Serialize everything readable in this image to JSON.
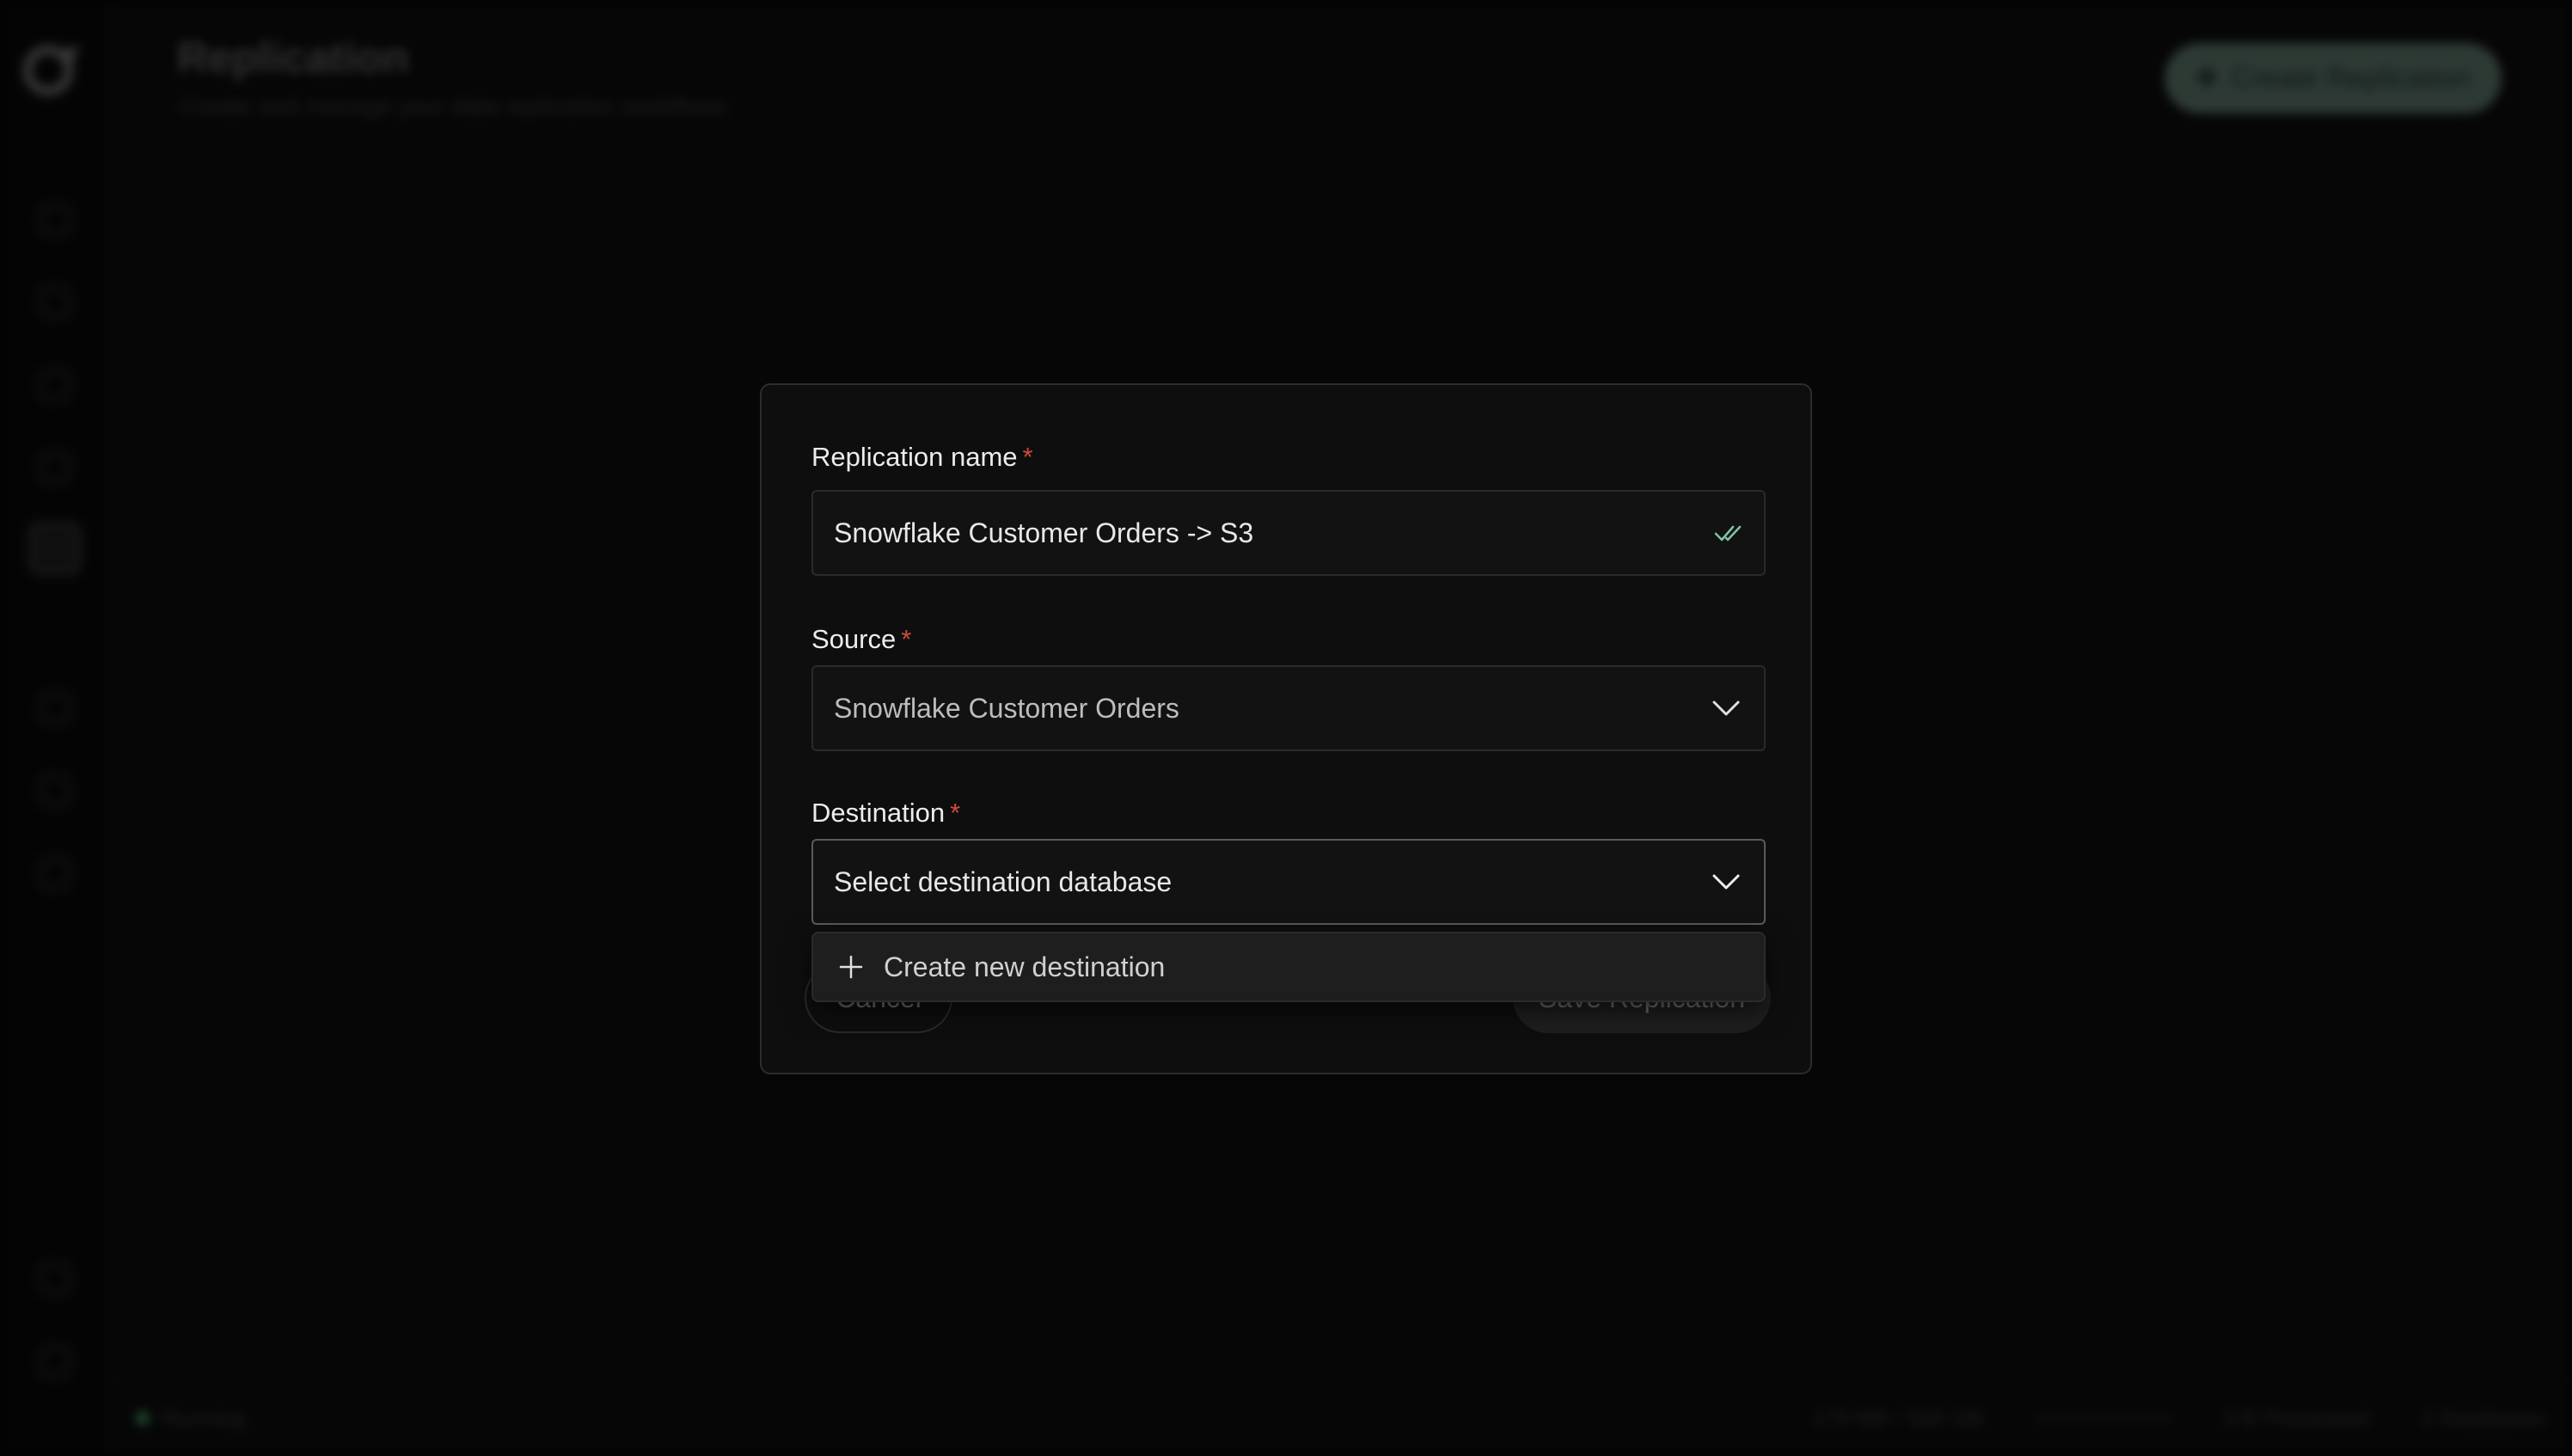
{
  "header": {
    "title": "Replication",
    "subtitle": "Create and manage your data replication workflows",
    "create_button": "Create Replication"
  },
  "statusbar": {
    "status": "Running",
    "memory": "179 MB / 500 GB",
    "processed": "0 B Processed",
    "databases": "2 Databases"
  },
  "modal": {
    "name_label": "Replication name",
    "name_value": "Snowflake Customer Orders -> S3",
    "source_label": "Source",
    "source_value": "Snowflake Customer Orders",
    "destination_label": "Destination",
    "destination_placeholder": "Select destination database",
    "required_mark": "*",
    "cancel_label": "Cancel",
    "save_label": "Save Replication"
  },
  "dropdown": {
    "create_new_label": "Create new destination"
  },
  "colors": {
    "accent": "#8fb8a6",
    "required": "#d04a3c",
    "check": "#7fc4a6"
  }
}
